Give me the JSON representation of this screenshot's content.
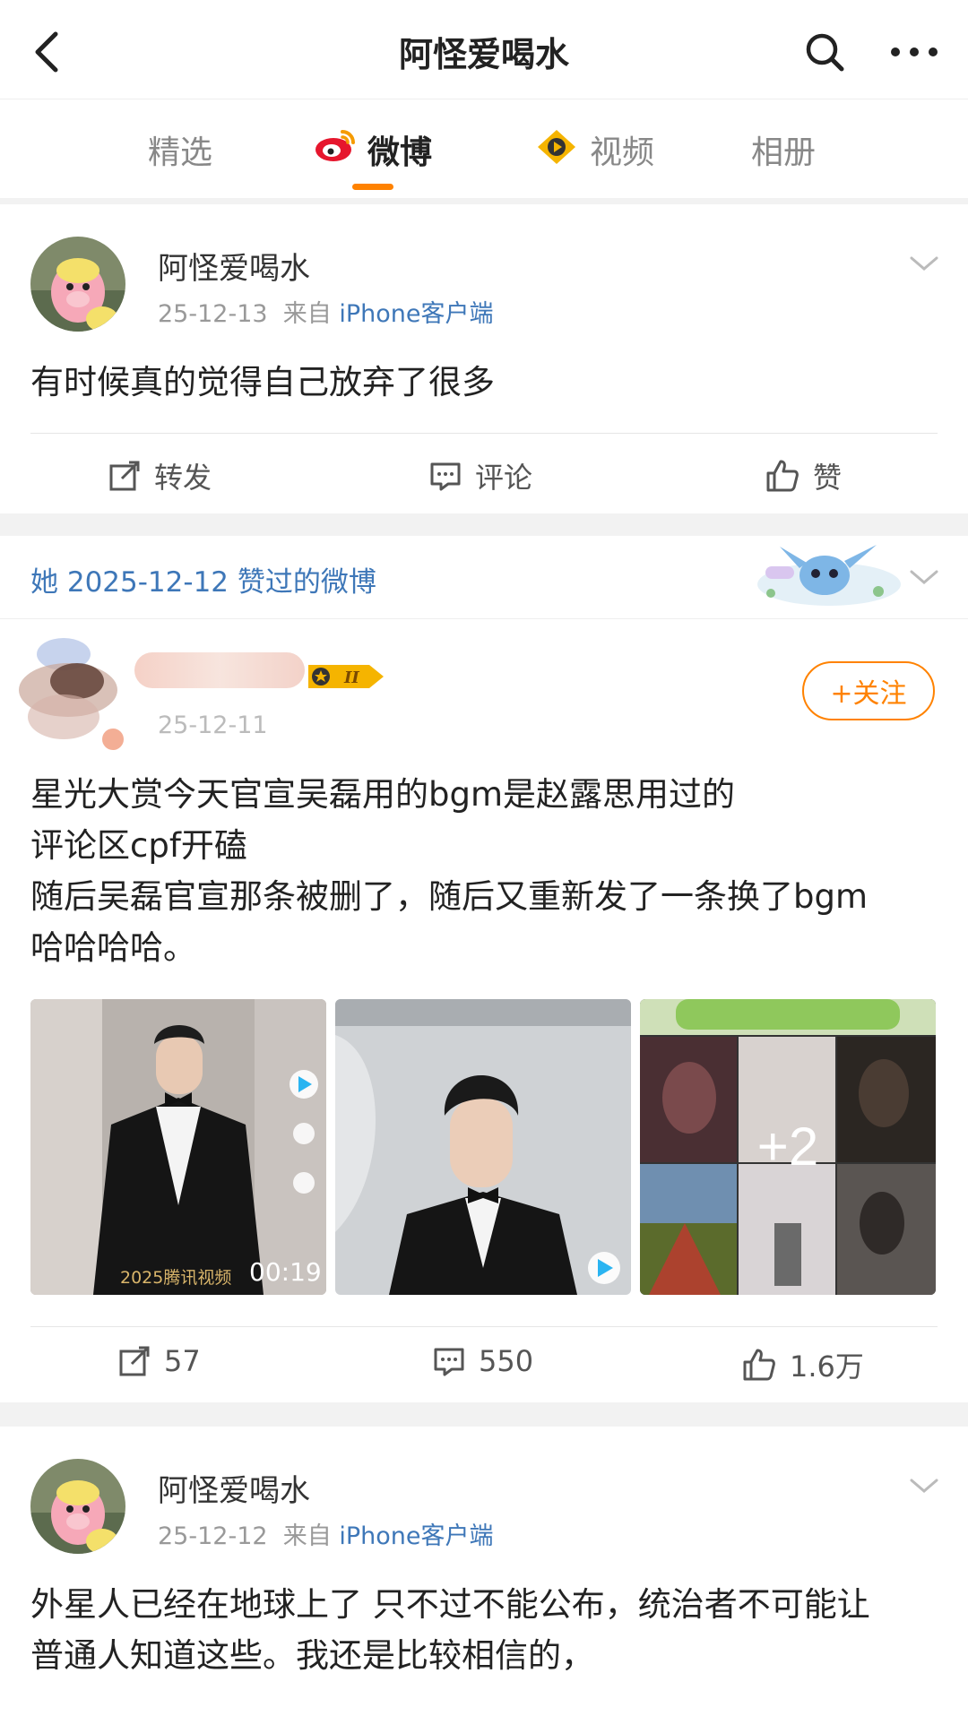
{
  "header": {
    "title": "阿怪爱喝水"
  },
  "tabs": [
    {
      "label": "精选"
    },
    {
      "label": "微博"
    },
    {
      "label": "视频"
    },
    {
      "label": "相册"
    }
  ],
  "posts": [
    {
      "user": "阿怪爱喝水",
      "date": "25-12-13",
      "source_prefix": "来自",
      "source": "iPhone客户端",
      "text": "有时候真的觉得自己放弃了很多",
      "repost": "转发",
      "comment": "评论",
      "like": "赞"
    },
    {
      "user": "阿怪爱喝水",
      "date": "25-12-12",
      "source_prefix": "来自",
      "source": "iPhone客户端",
      "text_lines": [
        "外星人已经在地球上了 只不过不能公布，统治者不可能让",
        "普通人知道这些。我还是比较相信的，"
      ]
    }
  ],
  "liked": {
    "label": "她 2025-12-12 赞过的微博",
    "date": "25-12-11",
    "follow": "+关注",
    "text_lines": [
      "星光大赏今天官宣吴磊用的bgm是赵露思用过的",
      "评论区cpf开磕",
      "随后吴磊官宣那条被删了，随后又重新发了一条换了bgm",
      "哈哈哈哈。"
    ],
    "images": {
      "duration": "00:19",
      "watermark": "2025腾讯视频",
      "more_count": "+2"
    },
    "reposts": "57",
    "comments": "550",
    "likes": "1.6万"
  }
}
